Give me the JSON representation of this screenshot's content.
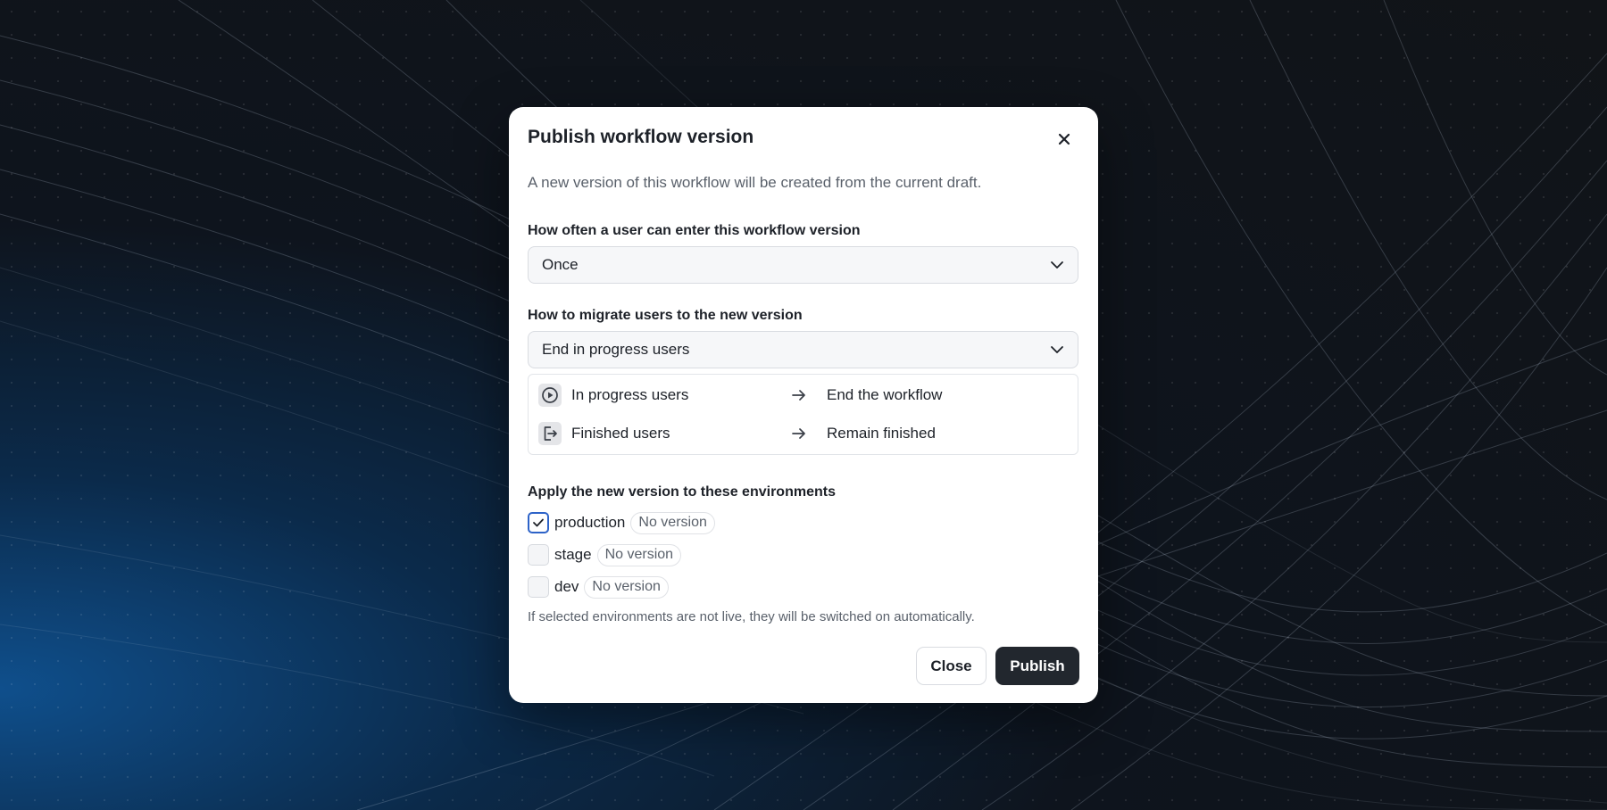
{
  "dialog": {
    "title": "Publish workflow version",
    "description": "A new version of this workflow will be created from the current draft."
  },
  "frequency": {
    "label": "How often a user can enter this workflow version",
    "selected": "Once"
  },
  "migration": {
    "label": "How to migrate users to the new version",
    "selected": "End in progress users",
    "rows": [
      {
        "icon": "play-circle-icon",
        "from": "In progress users",
        "to": "End the workflow"
      },
      {
        "icon": "exit-icon",
        "from": "Finished users",
        "to": "Remain finished"
      }
    ]
  },
  "environments": {
    "label": "Apply the new version to these environments",
    "items": [
      {
        "name": "production",
        "badge": "No version",
        "checked": true
      },
      {
        "name": "stage",
        "badge": "No version",
        "checked": false
      },
      {
        "name": "dev",
        "badge": "No version",
        "checked": false
      }
    ],
    "note": "If selected environments are not live, they will be switched on automatically."
  },
  "actions": {
    "close_label": "Close",
    "publish_label": "Publish"
  },
  "colors": {
    "primary_button": "#22272e",
    "checkbox_accent": "#2d63c8"
  }
}
